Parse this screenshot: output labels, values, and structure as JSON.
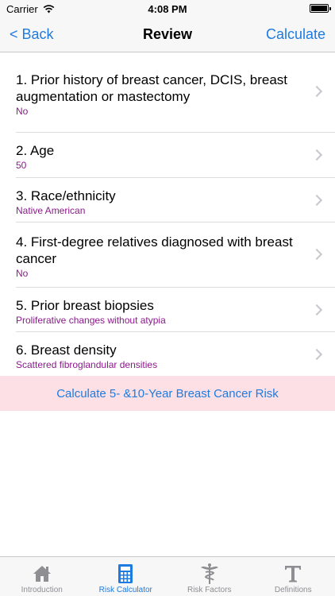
{
  "status": {
    "carrier": "Carrier",
    "time": "4:08 PM"
  },
  "nav": {
    "back": "< Back",
    "title": "Review",
    "action": "Calculate"
  },
  "items": [
    {
      "title": "1. Prior history of breast cancer, DCIS, breast augmentation or mastectomy",
      "value": "No"
    },
    {
      "title": "2. Age",
      "value": "50"
    },
    {
      "title": "3. Race/ethnicity",
      "value": "Native American"
    },
    {
      "title": "4. First-degree relatives diagnosed with breast cancer",
      "value": "No"
    },
    {
      "title": "5. Prior breast biopsies",
      "value": "Proliferative changes without atypia"
    },
    {
      "title": "6. Breast density",
      "value": "Scattered fibroglandular densities"
    }
  ],
  "calc_button": "Calculate 5- &10-Year Breast Cancer Risk",
  "tabs": [
    {
      "label": "Introduction",
      "icon": "home-icon"
    },
    {
      "label": "Risk Calculator",
      "icon": "calculator-icon",
      "active": true
    },
    {
      "label": "Risk Factors",
      "icon": "caduceus-icon"
    },
    {
      "label": "Definitions",
      "icon": "text-t-icon"
    }
  ],
  "colors": {
    "accent": "#1e7be0",
    "value_text": "#8b1a8b",
    "button_bg": "#fde0e5",
    "inactive_icon": "#8e8e93"
  }
}
